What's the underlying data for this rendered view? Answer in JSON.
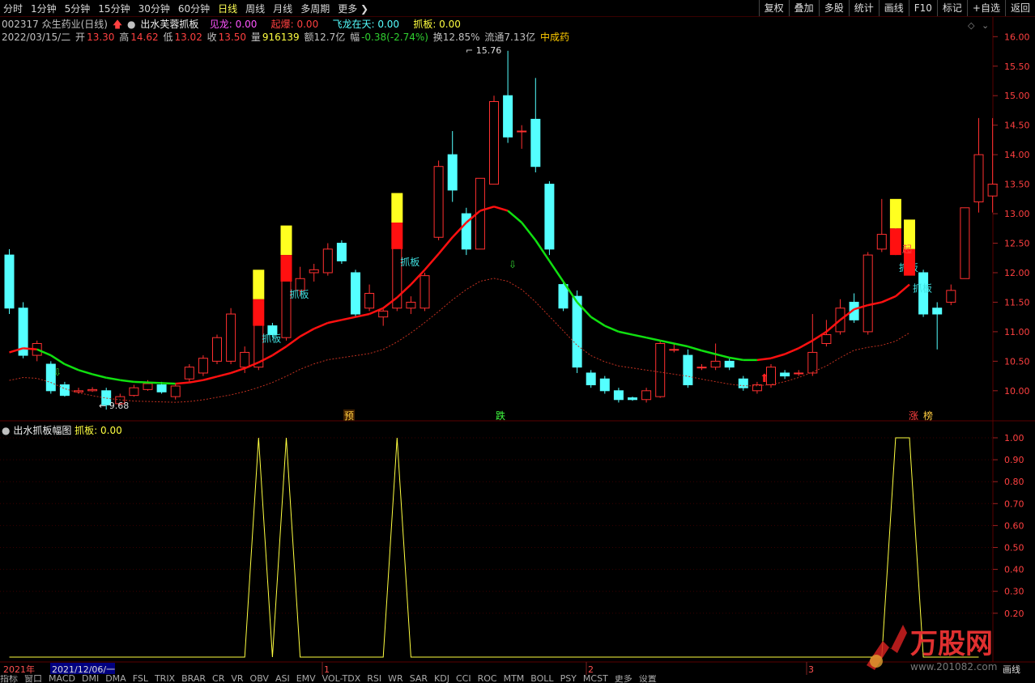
{
  "toolbar": {
    "periods": [
      "分时",
      "1分钟",
      "5分钟",
      "15分钟",
      "30分钟",
      "60分钟",
      "日线",
      "周线",
      "月线",
      "多周期",
      "更多"
    ],
    "active_period": "日线",
    "right_buttons": [
      "复权",
      "叠加",
      "多股",
      "统计",
      "画线",
      "F10",
      "标记",
      "+自选",
      "返回"
    ]
  },
  "header": {
    "code_name": "002317 众生药业(日线)",
    "indicator_name": "出水芙蓉抓板",
    "jianlong": "见龙: 0.00",
    "qibao": "起爆: 0.00",
    "feilong": "飞龙在天: 0.00",
    "zhuaban": "抓板: 0.00"
  },
  "quote": {
    "date": "2022/03/15/二",
    "open_label": "开",
    "open": "13.30",
    "high_label": "高",
    "high": "14.62",
    "low_label": "低",
    "low": "13.02",
    "close_label": "收",
    "close": "13.50",
    "vol_label": "量",
    "vol": "916139",
    "amount": "额12.7亿",
    "change_label": "幅",
    "change": "-0.38(-2.74%)",
    "turnover": "换12.85%",
    "float": "流通7.13亿",
    "sector": "中成药"
  },
  "price_axis": [
    "16.00",
    "15.50",
    "15.00",
    "14.50",
    "14.00",
    "13.50",
    "13.00",
    "12.50",
    "12.00",
    "11.50",
    "11.00",
    "10.50",
    "10.00"
  ],
  "annotations": {
    "high_mark": "15.76",
    "low_mark": "9.68",
    "zhuaban": "抓板",
    "qi": "起",
    "yu": "预",
    "die": "跌",
    "zhang": "涨",
    "bang": "榜"
  },
  "sub": {
    "title": "出水抓板幅图",
    "value": "抓板: 0.00",
    "axis": [
      "1.00",
      "0.90",
      "0.80",
      "0.70",
      "0.60",
      "0.50",
      "0.40",
      "0.30",
      "0.20"
    ]
  },
  "time_axis": {
    "year": "2021年",
    "cursor_date": "2021/12/06/一",
    "months": [
      "1",
      "2",
      "3"
    ],
    "right_label": "画线"
  },
  "bottom_tabs": [
    "指标",
    "窗口",
    "MACD",
    "DMI",
    "DMA",
    "FSL",
    "TRIX",
    "BRAR",
    "CR",
    "VR",
    "OBV",
    "ASI",
    "EMV",
    "VOL-TDX",
    "RSI",
    "WR",
    "SAR",
    "KDJ",
    "CCI",
    "ROC",
    "MTM",
    "BOLL",
    "PSY",
    "MCST",
    "更多",
    "设置"
  ],
  "watermark": {
    "brand": "万股网",
    "url": "www.201082.com"
  },
  "colors": {
    "up": "#ff3030",
    "down": "#54ffff",
    "ma_up": "#ff1010",
    "ma_down": "#10e010",
    "zhuaban_line": "#ffff40",
    "grid": "#5a0000"
  },
  "chart_data": {
    "type": "candlestick",
    "ylim": [
      9.6,
      16.1
    ],
    "candles": [
      [
        12.3,
        11.4,
        12.4,
        11.3
      ],
      [
        11.4,
        10.6,
        11.5,
        10.55
      ],
      [
        10.6,
        10.8,
        10.85,
        10.5
      ],
      [
        10.45,
        10.0,
        10.5,
        9.95
      ],
      [
        10.1,
        9.92,
        10.15,
        9.9
      ],
      [
        9.98,
        10.0,
        10.05,
        9.95
      ],
      [
        10.0,
        10.02,
        10.06,
        9.98
      ],
      [
        10.0,
        9.76,
        10.05,
        9.68
      ],
      [
        9.78,
        9.9,
        9.95,
        9.75
      ],
      [
        9.92,
        10.05,
        10.1,
        9.9
      ],
      [
        10.02,
        10.12,
        10.18,
        10.0
      ],
      [
        10.1,
        9.98,
        10.15,
        9.95
      ],
      [
        9.9,
        10.08,
        10.12,
        9.85
      ],
      [
        10.2,
        10.4,
        10.45,
        10.15
      ],
      [
        10.3,
        10.55,
        10.6,
        10.25
      ],
      [
        10.5,
        10.9,
        10.95,
        10.45
      ],
      [
        10.5,
        11.3,
        11.4,
        10.45
      ],
      [
        10.4,
        10.65,
        10.75,
        10.3
      ],
      [
        10.4,
        11.2,
        11.3,
        10.35
      ],
      [
        11.1,
        10.95,
        11.15,
        10.9
      ],
      [
        10.9,
        11.95,
        12.0,
        10.85
      ],
      [
        11.7,
        11.9,
        12.1,
        11.6
      ],
      [
        12.0,
        12.05,
        12.15,
        11.85
      ],
      [
        12.0,
        12.4,
        12.5,
        11.95
      ],
      [
        12.5,
        12.2,
        12.55,
        12.15
      ],
      [
        12.0,
        11.3,
        12.05,
        11.25
      ],
      [
        11.4,
        11.65,
        11.8,
        11.35
      ],
      [
        11.25,
        11.35,
        11.4,
        11.1
      ],
      [
        11.4,
        12.5,
        12.55,
        11.35
      ],
      [
        11.4,
        11.5,
        11.6,
        11.3
      ],
      [
        11.4,
        11.95,
        12.0,
        11.35
      ],
      [
        12.6,
        13.8,
        13.9,
        12.55
      ],
      [
        14.0,
        13.4,
        14.4,
        13.2
      ],
      [
        13.0,
        12.4,
        13.1,
        12.3
      ],
      [
        12.4,
        13.6,
        13.6,
        12.4
      ],
      [
        13.5,
        14.9,
        15.0,
        13.5
      ],
      [
        15.0,
        14.3,
        15.76,
        14.2
      ],
      [
        14.4,
        14.4,
        14.5,
        14.1
      ],
      [
        14.6,
        13.8,
        15.3,
        13.7
      ],
      [
        13.5,
        12.4,
        13.55,
        12.3
      ],
      [
        11.8,
        11.4,
        11.85,
        11.35
      ],
      [
        11.6,
        10.4,
        11.7,
        10.3
      ],
      [
        10.3,
        10.1,
        10.35,
        10.05
      ],
      [
        10.2,
        10.0,
        10.25,
        9.95
      ],
      [
        10.0,
        9.85,
        10.05,
        9.8
      ],
      [
        9.88,
        9.85,
        9.9,
        9.83
      ],
      [
        9.85,
        10.0,
        10.05,
        9.8
      ],
      [
        9.9,
        10.8,
        10.85,
        9.88
      ],
      [
        10.7,
        10.7,
        10.8,
        10.65
      ],
      [
        10.6,
        10.1,
        10.7,
        10.05
      ],
      [
        10.4,
        10.4,
        10.45,
        10.35
      ],
      [
        10.4,
        10.5,
        10.8,
        10.35
      ],
      [
        10.5,
        10.4,
        10.55,
        10.35
      ],
      [
        10.2,
        10.05,
        10.25,
        10.0
      ],
      [
        10.0,
        10.1,
        10.15,
        9.95
      ],
      [
        10.1,
        10.4,
        10.45,
        10.05
      ],
      [
        10.3,
        10.25,
        10.35,
        10.2
      ],
      [
        10.3,
        10.3,
        10.35,
        10.25
      ],
      [
        10.3,
        10.65,
        11.3,
        10.25
      ],
      [
        10.8,
        10.95,
        11.2,
        10.75
      ],
      [
        11.0,
        11.4,
        11.55,
        10.95
      ],
      [
        11.5,
        11.2,
        11.65,
        11.15
      ],
      [
        11.0,
        12.3,
        12.35,
        10.95
      ],
      [
        12.4,
        12.65,
        13.25,
        12.35
      ],
      [
        12.6,
        12.4,
        13.05,
        12.3
      ],
      [
        12.3,
        12.05,
        12.35,
        12.0
      ],
      [
        12.0,
        11.3,
        12.05,
        11.25
      ],
      [
        11.4,
        11.3,
        11.5,
        10.7
      ],
      [
        11.5,
        11.7,
        11.8,
        11.45
      ],
      [
        11.9,
        13.1,
        13.1,
        11.9
      ],
      [
        13.2,
        14.0,
        14.62,
        13.02
      ],
      [
        13.3,
        13.5,
        14.62,
        13.02
      ]
    ],
    "ma_line": [
      10.65,
      10.72,
      10.7,
      10.6,
      10.45,
      10.35,
      10.28,
      10.22,
      10.18,
      10.15,
      10.14,
      10.13,
      10.12,
      10.14,
      10.18,
      10.24,
      10.3,
      10.38,
      10.48,
      10.6,
      10.75,
      10.92,
      11.05,
      11.15,
      11.2,
      11.25,
      11.3,
      11.4,
      11.58,
      11.8,
      12.05,
      12.32,
      12.6,
      12.85,
      13.05,
      13.12,
      13.05,
      12.85,
      12.55,
      12.2,
      11.85,
      11.5,
      11.25,
      11.1,
      11.0,
      10.95,
      10.9,
      10.85,
      10.8,
      10.75,
      10.68,
      10.62,
      10.56,
      10.52,
      10.52,
      10.55,
      10.62,
      10.72,
      10.85,
      11.0,
      11.2,
      11.38,
      11.45,
      11.5,
      11.6,
      11.8
    ],
    "ma_colors": [
      "r",
      "r",
      "g",
      "g",
      "g",
      "g",
      "g",
      "g",
      "g",
      "g",
      "g",
      "g",
      "r",
      "r",
      "r",
      "r",
      "r",
      "r",
      "r",
      "r",
      "r",
      "r",
      "r",
      "r",
      "r",
      "r",
      "r",
      "r",
      "r",
      "r",
      "r",
      "r",
      "r",
      "r",
      "r",
      "r",
      "g",
      "g",
      "g",
      "g",
      "g",
      "g",
      "g",
      "g",
      "g",
      "g",
      "g",
      "g",
      "g",
      "g",
      "g",
      "g",
      "g",
      "g",
      "r",
      "r",
      "r",
      "r",
      "r",
      "r",
      "r",
      "r",
      "r",
      "r",
      "r",
      "r"
    ],
    "zhuaban_signal": [
      0,
      0,
      0,
      0,
      0,
      0,
      0,
      0,
      0,
      0,
      0,
      0,
      0,
      0,
      0,
      0,
      0,
      0,
      1,
      0,
      1,
      0,
      0,
      0,
      0,
      0,
      0,
      0,
      1,
      0,
      0,
      0,
      0,
      0,
      0,
      0,
      0,
      0,
      0,
      0,
      0,
      0,
      0,
      0,
      0,
      0,
      0,
      0,
      0,
      0,
      0,
      0,
      0,
      0,
      0,
      0,
      0,
      0,
      0,
      0,
      0,
      0,
      0,
      0,
      1,
      1,
      0,
      0,
      0,
      0,
      0
    ]
  }
}
